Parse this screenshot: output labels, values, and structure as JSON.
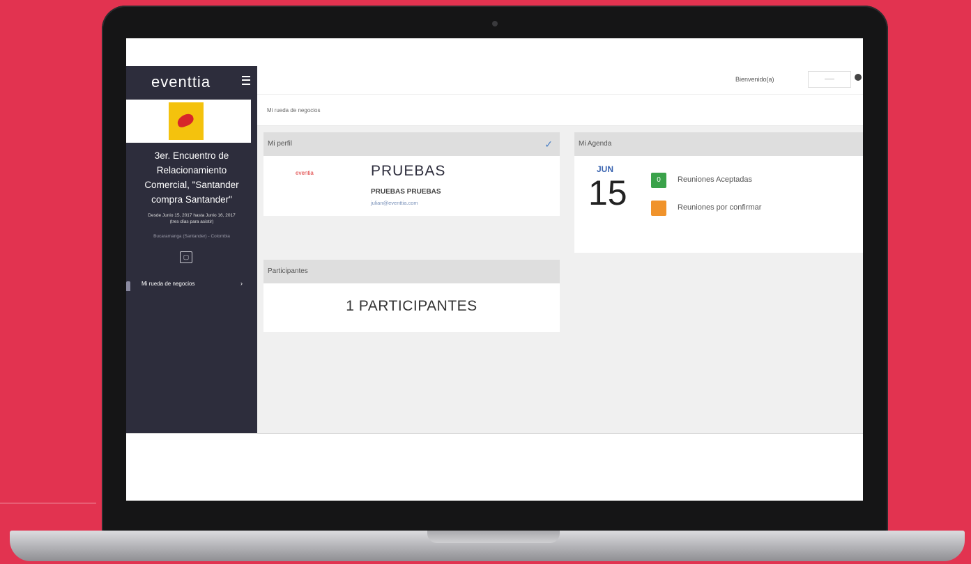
{
  "app": {
    "logo": "eventtia",
    "header_welcome": "Bienvenido(a)",
    "user_select_value": "——"
  },
  "sidebar": {
    "event_title_lines": [
      "3er. Encuentro de",
      "Relacionamiento",
      "Comercial, \"Santander",
      "compra Santander\""
    ],
    "event_dates_lines": [
      "Desde Junio 15, 2017 hasta Junio 16, 2017",
      "(tres días para asistir)"
    ],
    "event_place": "Bucaramanga (Santander) - Colombia",
    "nav_item": "Mi rueda de negocios",
    "nav_arrow": "›"
  },
  "main": {
    "breadcrumb": "Mi rueda de negocios",
    "profile_panel": {
      "title": "Mi perfil",
      "check_icon": "✓",
      "company_logo_text": "eventia",
      "name": "PRUEBAS",
      "subtitle": "PRUEBAS PRUEBAS",
      "email": "julian@eventtia.com"
    },
    "participants_panel": {
      "title": "Participantes",
      "count_text": "1 PARTICIPANTES"
    },
    "agenda_panel": {
      "title": "Mi Agenda",
      "month": "JUN",
      "day": "15",
      "legend": [
        {
          "label": "Reuniones Aceptadas",
          "value": "0",
          "color": "#3aa24a"
        },
        {
          "label": "Reuniones por confirmar",
          "value": "",
          "color": "#f0932b"
        }
      ]
    }
  },
  "colors": {
    "background": "#e23350",
    "sidebar": "#2d2d3c",
    "accent_blue": "#3a64b0"
  }
}
